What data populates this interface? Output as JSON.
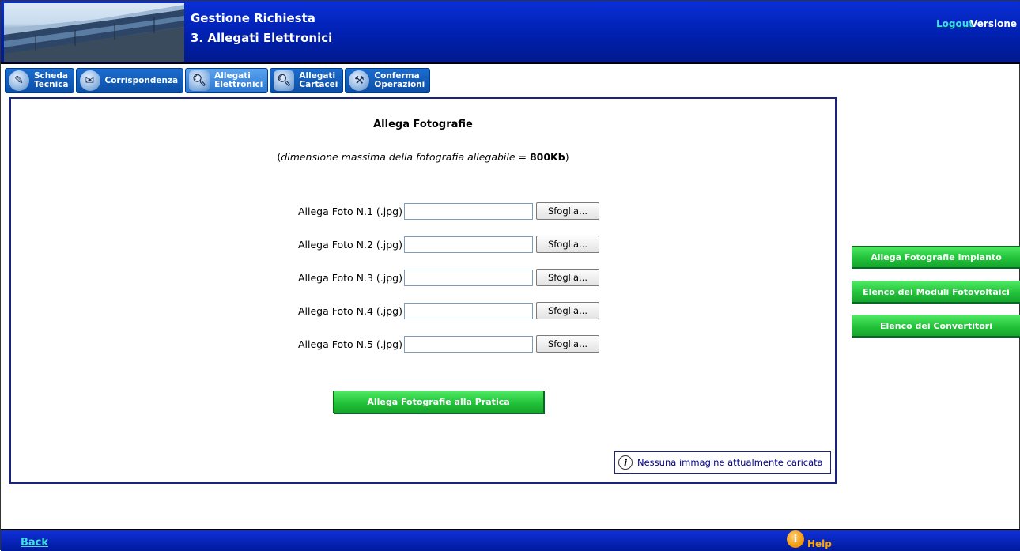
{
  "header": {
    "title_line1": "Gestione Richiesta",
    "title_line2": "3. Allegati Elettronici",
    "logout": "Logout",
    "versione": "Versione"
  },
  "tabs": [
    {
      "label_l1": "Scheda",
      "label_l2": "Tecnica",
      "icon": "pencil-icon"
    },
    {
      "label_l1": "Corrispondenza",
      "label_l2": "",
      "icon": "envelope-icon"
    },
    {
      "label_l1": "Allegati",
      "label_l2": "Elettronici",
      "icon": "magnifier-document-icon"
    },
    {
      "label_l1": "Allegati",
      "label_l2": "Cartacei",
      "icon": "magnifier-document-icon"
    },
    {
      "label_l1": "Conferma",
      "label_l2": "Operazioni",
      "icon": "tools-icon"
    }
  ],
  "main": {
    "title": "Allega Fotografie",
    "subtitle_prefix": "(",
    "subtitle_italic": "dimensione massima della fotografia allegabile",
    "subtitle_eq": " = ",
    "subtitle_bold": "800Kb",
    "subtitle_suffix": ")",
    "photos": [
      {
        "label": "Allega Foto N.1  (.jpg)",
        "button": "Sfoglia..."
      },
      {
        "label": "Allega Foto N.2  (.jpg)",
        "button": "Sfoglia..."
      },
      {
        "label": "Allega Foto N.3  (.jpg)",
        "button": "Sfoglia..."
      },
      {
        "label": "Allega Foto N.4  (.jpg)",
        "button": "Sfoglia..."
      },
      {
        "label": "Allega Foto N.5  (.jpg)",
        "button": "Sfoglia..."
      }
    ],
    "submit": "Allega Fotografie alla Pratica",
    "info": "Nessuna immagine attualmente caricata"
  },
  "side": {
    "btn1": "Allega Fotografie Impianto",
    "btn2": "Elenco dei Moduli Fotovoltaici",
    "btn3": "Elenco dei Convertitori"
  },
  "footer": {
    "back": "Back",
    "help": "Help"
  },
  "colors": {
    "header_bg": "#0020b0",
    "link": "#40e0e0",
    "green_button": "#22c23a",
    "help": "#ffa500"
  }
}
